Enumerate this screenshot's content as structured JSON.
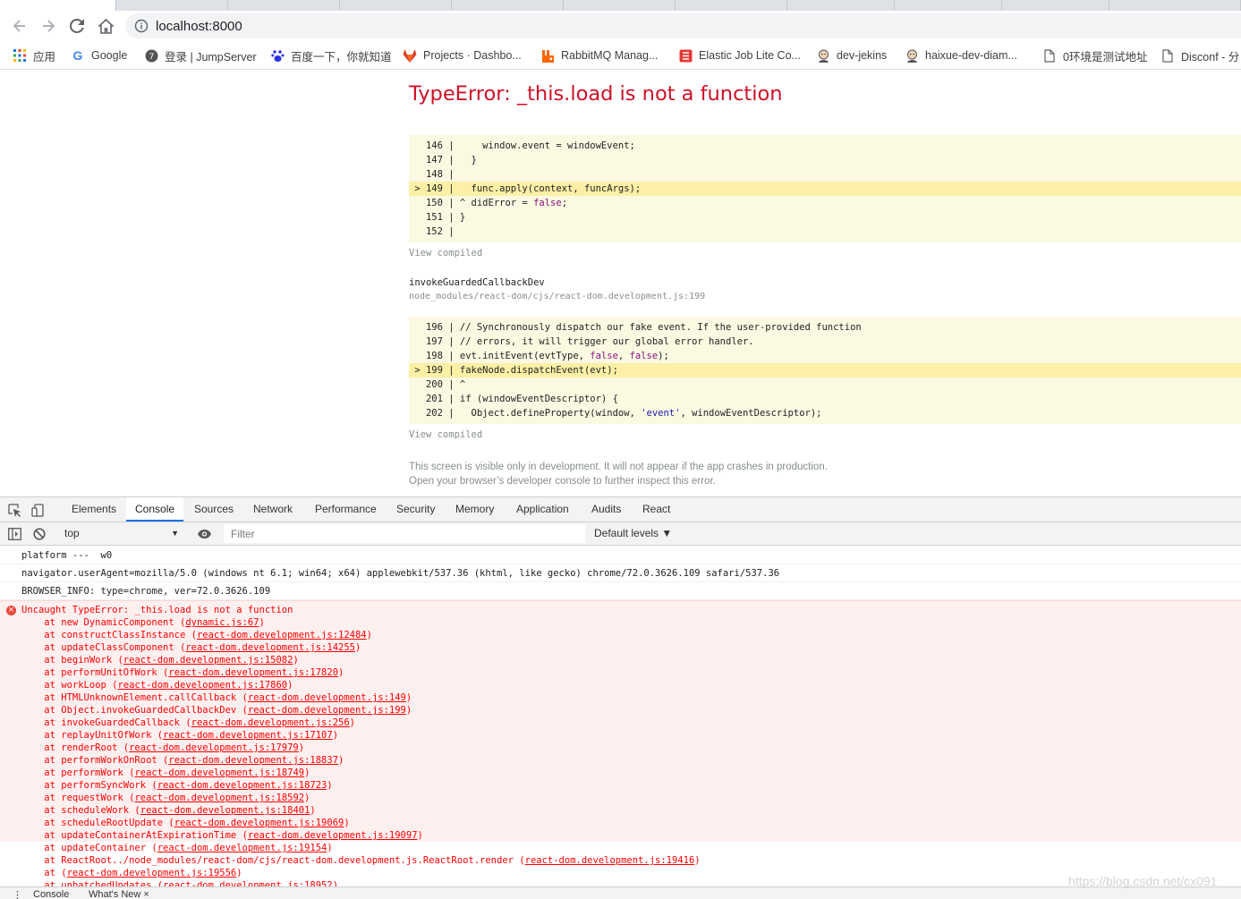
{
  "browser": {
    "address": "localhost:8000",
    "bookmarks": [
      {
        "label": "应用",
        "icon": "apps-grid-icon"
      },
      {
        "label": "Google",
        "icon": "google-icon"
      },
      {
        "label": "登录 | JumpServer",
        "icon": "jumpserver-icon"
      },
      {
        "label": "百度一下，你就知道",
        "icon": "baidu-icon"
      },
      {
        "label": "Projects · Dashbo...",
        "icon": "gitlab-icon"
      },
      {
        "label": "RabbitMQ Manag...",
        "icon": "rabbitmq-icon"
      },
      {
        "label": "Elastic Job Lite Co...",
        "icon": "elasticjob-icon"
      },
      {
        "label": "dev-jekins",
        "icon": "jenkins-icon"
      },
      {
        "label": "haixue-dev-diam...",
        "icon": "jenkins-icon"
      },
      {
        "label": "0环境是测试地址",
        "icon": "page-icon"
      },
      {
        "label": "Disconf - 分",
        "icon": "page-icon"
      }
    ]
  },
  "error_overlay": {
    "title": "TypeError: _this.load is not a function",
    "view_compiled": "View compiled",
    "block1": [
      {
        "num": "146",
        "marker": " ",
        "code": "    window.event = windowEvent;",
        "hl": false
      },
      {
        "num": "147",
        "marker": " ",
        "code": "  }",
        "hl": false
      },
      {
        "num": "148",
        "marker": " ",
        "code": "",
        "hl": false
      },
      {
        "num": "149",
        "marker": ">",
        "code": "  func.apply(context, funcArgs);",
        "hl": true
      },
      {
        "num": "150",
        "marker": " ",
        "code": "^ didError = false;",
        "hl": false
      },
      {
        "num": "151",
        "marker": " ",
        "code": "}",
        "hl": false
      },
      {
        "num": "152",
        "marker": " ",
        "code": "",
        "hl": false
      }
    ],
    "frame2_name": "invokeGuardedCallbackDev",
    "frame2_file": "node_modules/react-dom/cjs/react-dom.development.js:199",
    "block2": [
      {
        "num": "196",
        "marker": " ",
        "code": "// Synchronously dispatch our fake event. If the user-provided function",
        "hl": false
      },
      {
        "num": "197",
        "marker": " ",
        "code": "// errors, it will trigger our global error handler.",
        "hl": false
      },
      {
        "num": "198",
        "marker": " ",
        "code": "evt.initEvent(evtType, false, false);",
        "hl": false
      },
      {
        "num": "199",
        "marker": ">",
        "code": "fakeNode.dispatchEvent(evt);",
        "hl": true
      },
      {
        "num": "200",
        "marker": " ",
        "code": "^",
        "hl": false
      },
      {
        "num": "201",
        "marker": " ",
        "code": "if (windowEventDescriptor) {",
        "hl": false
      },
      {
        "num": "202",
        "marker": " ",
        "code": "  Object.defineProperty(window, 'event', windowEventDescriptor);",
        "hl": false
      }
    ],
    "footer_line1": "This screen is visible only in development. It will not appear if the app crashes in production.",
    "footer_line2": "Open your browser’s developer console to further inspect this error."
  },
  "devtools": {
    "tabs": [
      "Elements",
      "Console",
      "Sources",
      "Network",
      "Performance",
      "Security",
      "Memory",
      "Application",
      "Audits",
      "React"
    ],
    "active_tab": "Console",
    "context": "top",
    "filter_placeholder": "Filter",
    "levels": "Default levels ▼",
    "logs": [
      "platform ---  w0",
      "navigator.userAgent=mozilla/5.0 (windows nt 6.1; win64; x64) applewebkit/537.36 (khtml, like gecko) chrome/72.0.3626.109 safari/537.36",
      "BROWSER_INFO: type=chrome, ver=72.0.3626.109"
    ],
    "error_head": "Uncaught TypeError: _this.load is not a function",
    "stack": [
      {
        "fn": "new DynamicComponent",
        "loc": "dynamic.js:67"
      },
      {
        "fn": "constructClassInstance",
        "loc": "react-dom.development.js:12484"
      },
      {
        "fn": "updateClassComponent",
        "loc": "react-dom.development.js:14255"
      },
      {
        "fn": "beginWork",
        "loc": "react-dom.development.js:15082"
      },
      {
        "fn": "performUnitOfWork",
        "loc": "react-dom.development.js:17820"
      },
      {
        "fn": "workLoop",
        "loc": "react-dom.development.js:17860"
      },
      {
        "fn": "HTMLUnknownElement.callCallback",
        "loc": "react-dom.development.js:149"
      },
      {
        "fn": "Object.invokeGuardedCallbackDev",
        "loc": "react-dom.development.js:199"
      },
      {
        "fn": "invokeGuardedCallback",
        "loc": "react-dom.development.js:256"
      },
      {
        "fn": "replayUnitOfWork",
        "loc": "react-dom.development.js:17107"
      },
      {
        "fn": "renderRoot",
        "loc": "react-dom.development.js:17979"
      },
      {
        "fn": "performWorkOnRoot",
        "loc": "react-dom.development.js:18837"
      },
      {
        "fn": "performWork",
        "loc": "react-dom.development.js:18749"
      },
      {
        "fn": "performSyncWork",
        "loc": "react-dom.development.js:18723"
      },
      {
        "fn": "requestWork",
        "loc": "react-dom.development.js:18592"
      },
      {
        "fn": "scheduleWork",
        "loc": "react-dom.development.js:18401"
      },
      {
        "fn": "scheduleRootUpdate",
        "loc": "react-dom.development.js:19069"
      },
      {
        "fn": "updateContainerAtExpirationTime",
        "loc": "react-dom.development.js:19097"
      },
      {
        "fn": "updateContainer",
        "loc": "react-dom.development.js:19154"
      },
      {
        "fn": "ReactRoot../node_modules/react-dom/cjs/react-dom.development.js.ReactRoot.render",
        "loc": "react-dom.development.js:19416"
      },
      {
        "fn": "",
        "loc": "react-dom.development.js:19556"
      },
      {
        "fn": "unbatchedUpdates",
        "loc": "react-dom.development.js:18952"
      }
    ],
    "drawer_tabs": [
      "Console",
      "What's New ×"
    ]
  },
  "watermark": "https://blog.csdn.net/cx091",
  "colors": {
    "error_red": "#ce1126",
    "console_error": "#ff0000",
    "code_bg": "#fbf9e2",
    "code_hl": "#fbf0a6",
    "active_tab": "#1a73e8"
  }
}
